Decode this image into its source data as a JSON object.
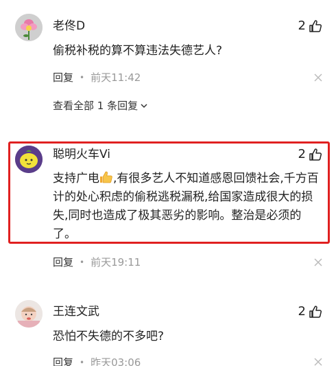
{
  "comments": [
    {
      "username": "老佟D",
      "likes": "2",
      "text": "偷税补税的算不算违法失德艺人?",
      "reply_label": "回复",
      "time": "前天11:42",
      "view_replies": "查看全部 1 条回复"
    },
    {
      "username": "聪明火车Vi",
      "likes": "2",
      "text_before_emoji": "支持广电",
      "text_after_emoji": ",有很多艺人不知道感恩回馈社会,千方百计的处心积虑的偷税逃税漏税,给国家造成很大的损失,同时也造成了极其恶劣的影响。整治是必须的了。",
      "reply_label": "回复",
      "time": "前天19:11"
    },
    {
      "username": "王连文武",
      "likes": "2",
      "text": "恐怕不失德的不多吧?",
      "reply_label": "回复",
      "time": "昨天03:06"
    }
  ],
  "icons": {
    "like": "thumbs-up-icon",
    "close": "close-icon",
    "expand": "chevron-down-icon",
    "emoji": "thumbs-up-emoji"
  },
  "colors": {
    "highlight_border": "#e02020",
    "secondary_text": "#999999"
  }
}
